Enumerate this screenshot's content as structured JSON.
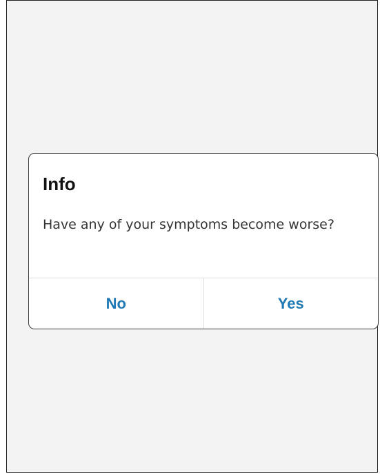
{
  "dialog": {
    "title": "Info",
    "message": "Have any of your symptoms become worse?",
    "buttons": {
      "no_label": "No",
      "yes_label": "Yes"
    }
  },
  "colors": {
    "background": "#f3f3f3",
    "dialog_background": "#ffffff",
    "button_text": "#1f79b4",
    "title_text": "#111111",
    "message_text": "#333333",
    "divider": "#dedede"
  }
}
